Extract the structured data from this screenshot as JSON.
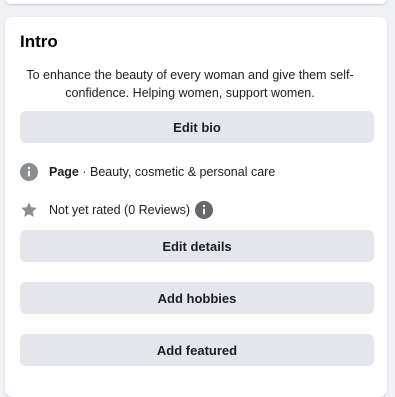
{
  "intro": {
    "title": "Intro",
    "bio": "To enhance the beauty of every woman and give them self-confidence. Helping women, support women.",
    "edit_bio_label": "Edit bio",
    "page_label": "Page",
    "page_category": " · Beauty, cosmetic & personal care",
    "rating_text": "Not yet rated (0 Reviews)",
    "edit_details_label": "Edit details",
    "add_hobbies_label": "Add hobbies",
    "add_featured_label": "Add featured"
  },
  "icons": {
    "info": "info-icon",
    "star": "star-icon",
    "info_small": "info-icon"
  },
  "colors": {
    "button_bg": "#e4e6eb",
    "icon_gray": "#8a8d91",
    "icon_dark": "#65676b"
  }
}
